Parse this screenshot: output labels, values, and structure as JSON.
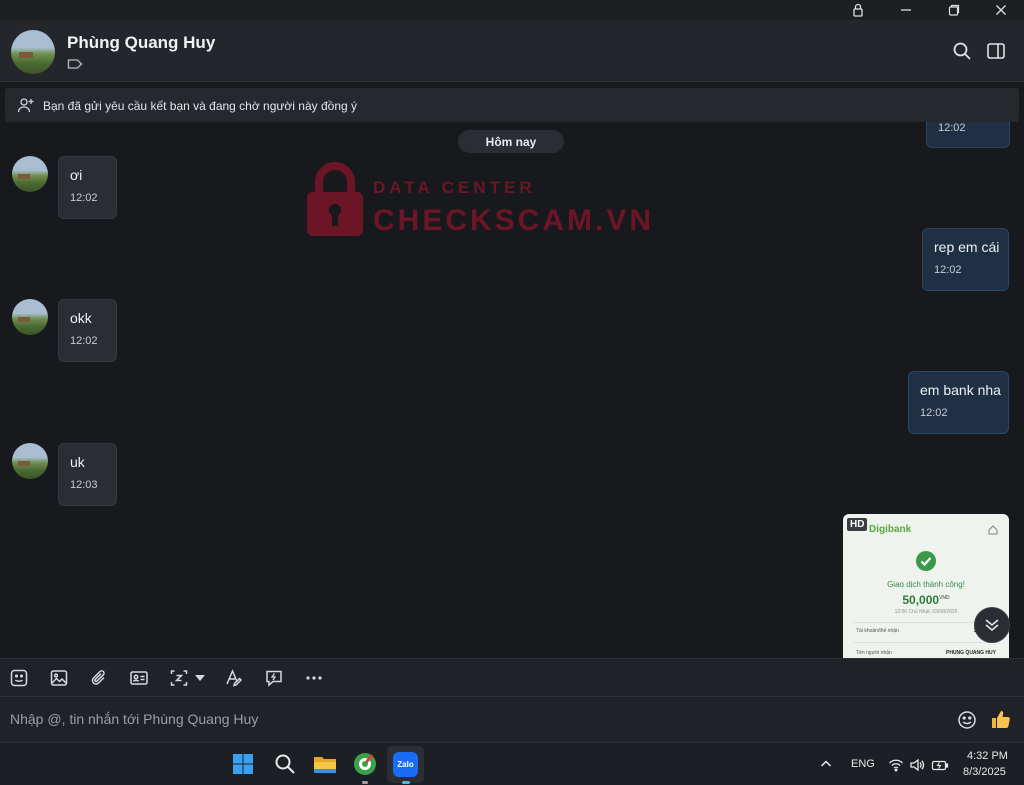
{
  "header": {
    "contact_name": "Phùng Quang Huy"
  },
  "notice": {
    "text": "Bạn đã gửi yêu cầu kết bạn và đang chờ người này đồng ý"
  },
  "chat": {
    "date_separator": "Hôm nay",
    "partial_out_time": "12:02",
    "messages": [
      {
        "direction": "in",
        "text": "ơi",
        "time": "12:02"
      },
      {
        "direction": "out",
        "text": "rep em cái",
        "time": "12:02"
      },
      {
        "direction": "in",
        "text": "okk",
        "time": "12:02"
      },
      {
        "direction": "out",
        "text": "em bank nha",
        "time": "12:02"
      },
      {
        "direction": "in",
        "text": "uk",
        "time": "12:03"
      }
    ],
    "receipt": {
      "badge": "HD",
      "brand": "Digibank",
      "status": "Giao dịch thành công!",
      "amount": "50,000",
      "currency": "VND",
      "date": "12:06 Chủ Nhật, 03/08/2025",
      "row1_label": "Tài khoản/thẻ nhận",
      "row1_value": "30776891",
      "row2_label": "Tên người nhận",
      "row2_value": "PHUNG QUANG HUY"
    }
  },
  "watermark": {
    "line1": "DATA CENTER",
    "line2": "CHECKSCAM.VN"
  },
  "composer": {
    "placeholder": "Nhập @, tin nhắn tới Phùng Quang Huy"
  },
  "taskbar": {
    "zalo_label": "Zalo",
    "language": "ENG",
    "time": "4:32 PM",
    "date": "8/3/2025"
  },
  "colors": {
    "background": "#17191d",
    "incoming_bubble": "#2a2d33",
    "outgoing_bubble": "#1f3045",
    "watermark": "#b01230"
  }
}
